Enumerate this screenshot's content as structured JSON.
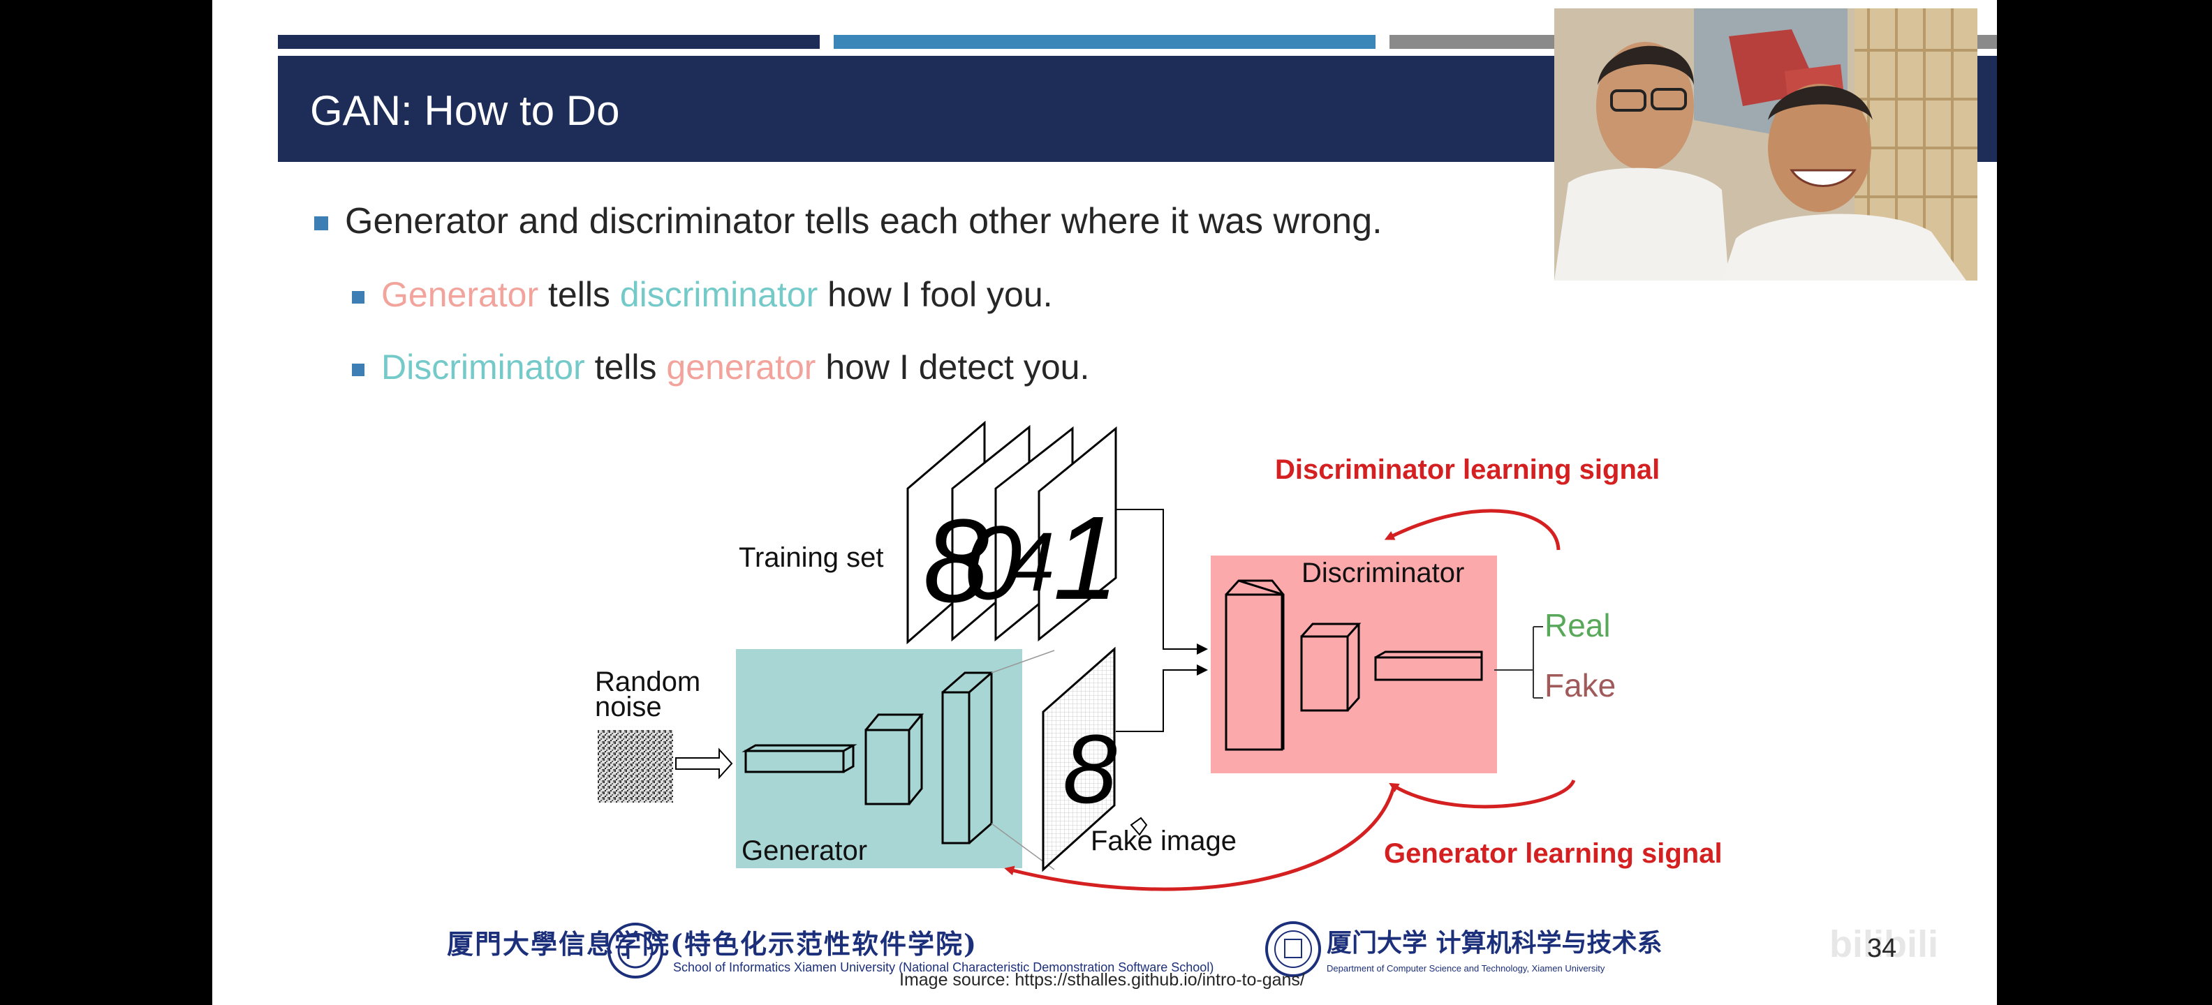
{
  "slide": {
    "title": "GAN: How to Do",
    "bullet1": "Generator and discriminator tells each other where it was wrong.",
    "bullet2": {
      "part1": "Generator",
      "part2": " tells ",
      "part3": "discriminator",
      "part4": " how I fool you."
    },
    "bullet3": {
      "part1": "Discriminator",
      "part2": " tells ",
      "part3": "generator",
      "part4": " how I detect you."
    },
    "page_number": "34"
  },
  "diagram": {
    "training_set": "Training set",
    "random_noise_1": "Random",
    "random_noise_2": "noise",
    "generator": "Generator",
    "fake_image": "Fake image",
    "discriminator": "Discriminator",
    "real": "Real",
    "fake": "Fake",
    "disc_signal": "Discriminator learning signal",
    "gen_signal": "Generator learning signal",
    "digits": [
      "8",
      "0",
      "4",
      "1"
    ],
    "fake_digit": "8"
  },
  "footer": {
    "xmu_cn": "厦門大學信息学院(特色化示范性软件学院)",
    "xmu_en": "School of Informatics Xiamen University (National Characteristic Demonstration Software School)",
    "cs_cn": "厦门大学 计算机科学与技术系",
    "cs_en": "Department of Computer Science and Technology, Xiamen University",
    "image_source": "Image source: https://sthalles.github.io/intro-to-gans/",
    "watermark": "bilibili"
  },
  "colors": {
    "title_bar": "#1d2d58",
    "accent_pink": "#f2a39c",
    "accent_teal": "#74c9c9",
    "signal_red": "#d42020",
    "real_green": "#58a85a",
    "fake_brown": "#a05a5a"
  }
}
